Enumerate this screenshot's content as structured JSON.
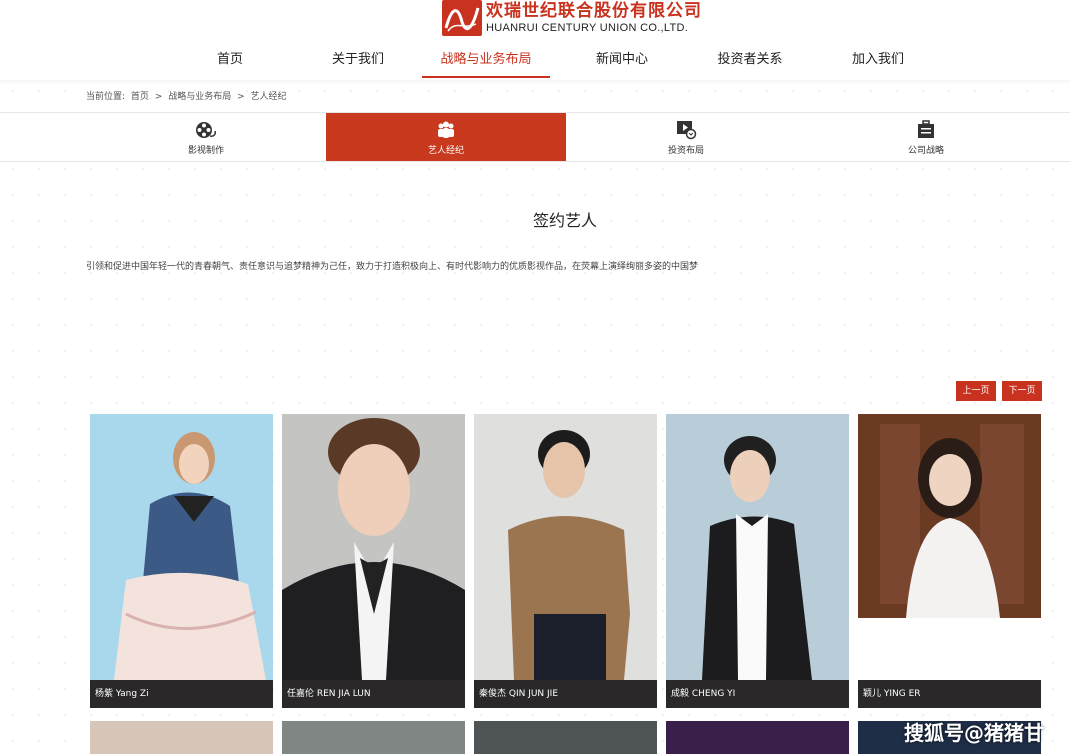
{
  "header": {
    "logo_cn": "欢瑞世纪联合股份有限公司",
    "logo_en": "HUANRUI CENTURY UNION CO.,LTD.",
    "brand_color": "#c8321e"
  },
  "nav": {
    "items": [
      {
        "label": "首页"
      },
      {
        "label": "关于我们"
      },
      {
        "label": "战略与业务布局"
      },
      {
        "label": "新闻中心"
      },
      {
        "label": "投资者关系"
      },
      {
        "label": "加入我们"
      }
    ],
    "active_index": 2
  },
  "breadcrumb": {
    "prefix": "当前位置:",
    "items": [
      "首页",
      ">",
      "战略与业务布局",
      ">",
      "艺人经纪"
    ]
  },
  "subnav": {
    "items": [
      {
        "label": "影视制作",
        "icon": "film-reel-icon"
      },
      {
        "label": "艺人经纪",
        "icon": "people-icon"
      },
      {
        "label": "投资布局",
        "icon": "video-investment-icon"
      },
      {
        "label": "公司战略",
        "icon": "briefcase-icon"
      }
    ],
    "active_index": 1
  },
  "main": {
    "title": "签约艺人",
    "intro": "引领和促进中国年轻一代的青春朝气、责任意识与追梦精神为己任，致力于打造积极向上、有时代影响力的优质影视作品，在荧幕上演绎绚丽多姿的中国梦"
  },
  "pager": {
    "prev": "上一页",
    "next": "下一页"
  },
  "artists": [
    {
      "name": "杨紫 Yang Zi"
    },
    {
      "name": "任嘉伦 REN JIA LUN"
    },
    {
      "name": "秦俊杰 QIN JUN JIE"
    },
    {
      "name": "成毅 CHENG YI"
    },
    {
      "name": "颖儿 YING ER"
    }
  ],
  "watermark": "搜狐号@猪猪甘"
}
